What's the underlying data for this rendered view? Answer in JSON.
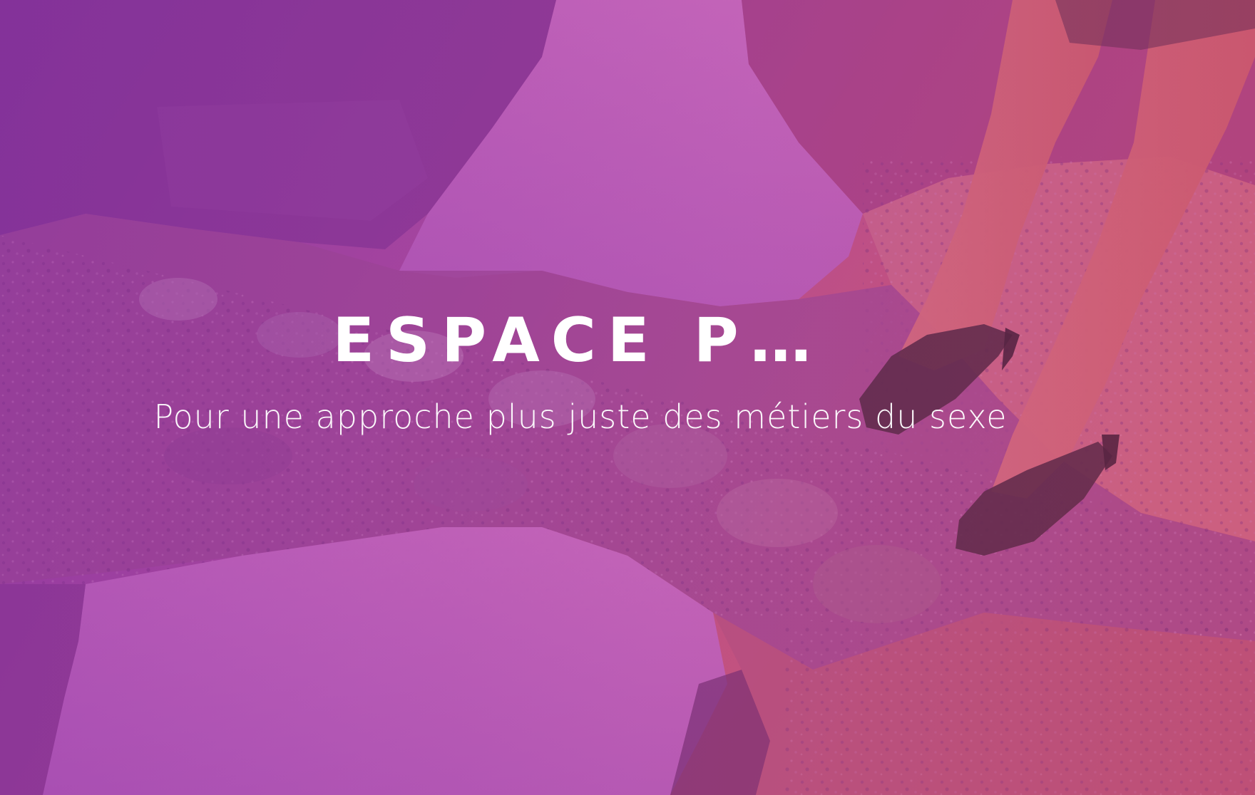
{
  "hero": {
    "title": "ESPACE P…",
    "subtitle": "Pour une approche plus juste des métiers du sexe"
  },
  "photo": {
    "description_icon": "street-puddle-photo",
    "tint_colors": {
      "purple": "#8a3ca6",
      "violet": "#b85cc0",
      "pink": "#c8507e",
      "coral": "#d4606e"
    }
  }
}
